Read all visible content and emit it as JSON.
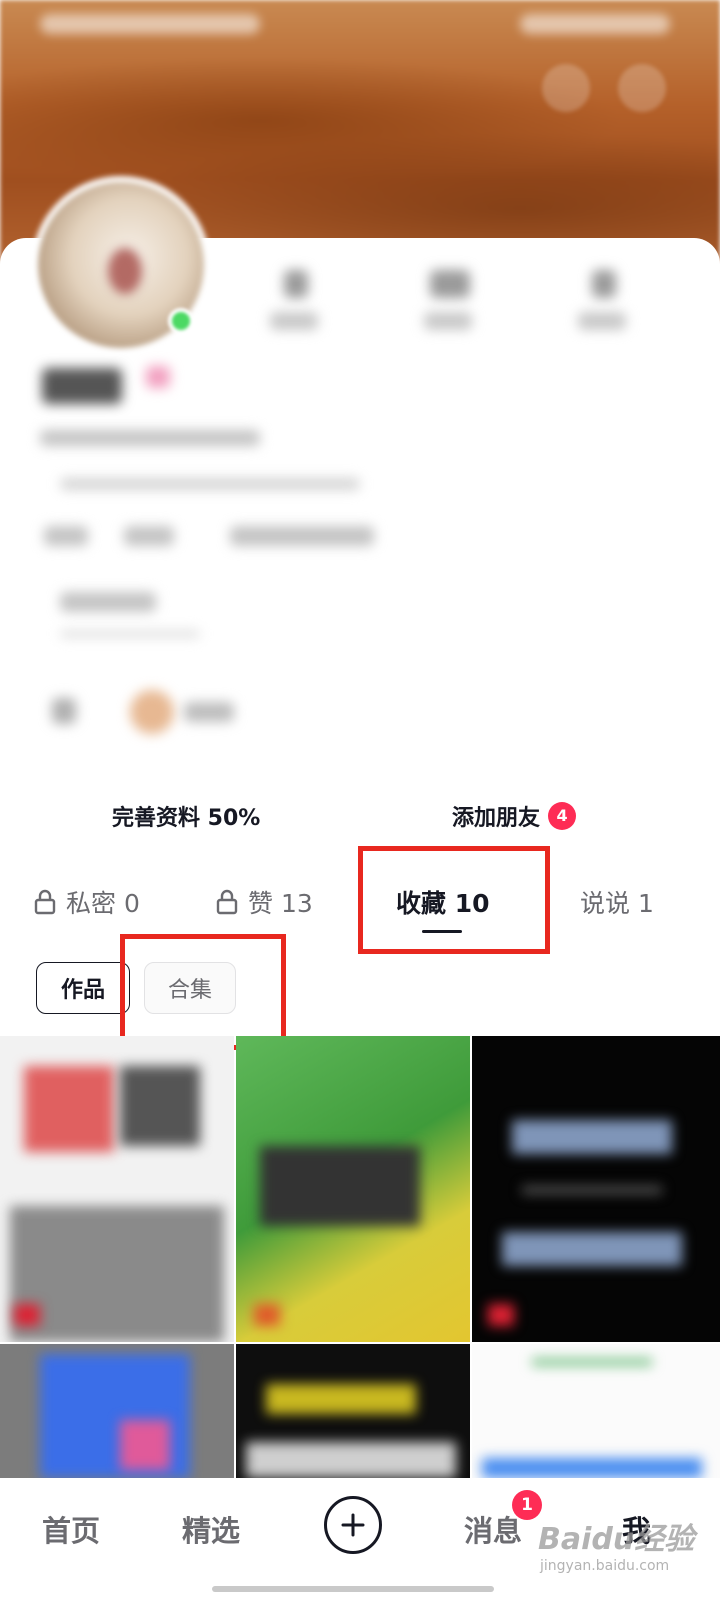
{
  "profile_actions": {
    "complete_profile": "完善资料 50%",
    "add_friends": "添加朋友",
    "add_friends_badge": "4"
  },
  "tabs": [
    {
      "label": "私密 0",
      "icon": "lock-icon",
      "active": false
    },
    {
      "label": "赞 13",
      "icon": "lock-icon",
      "active": false
    },
    {
      "label": "收藏 10",
      "active": true
    },
    {
      "label": "说说 1",
      "active": false
    }
  ],
  "sub_tabs": [
    {
      "label": "作品",
      "selected": true
    },
    {
      "label": "合集",
      "selected": false
    }
  ],
  "bottom_nav": {
    "home": "首页",
    "featured": "精选",
    "create_icon": "plus-icon",
    "messages": "消息",
    "messages_badge": "1",
    "me": "我"
  },
  "watermark": {
    "logo": "Baidu经验",
    "url": "jingyan.baidu.com"
  },
  "colors": {
    "accent_red": "#fe2c55",
    "annotation_red": "#e8281f",
    "text_primary": "#161823",
    "text_secondary": "#6b6b70"
  }
}
